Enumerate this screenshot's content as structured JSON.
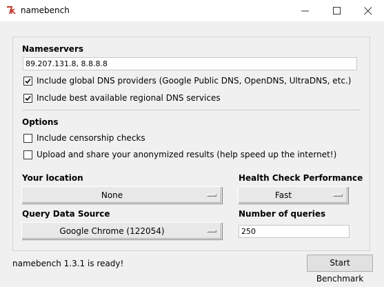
{
  "window": {
    "title": "namebench",
    "app_icon": "tk-feather-icon",
    "minimize_icon": "minimize-icon",
    "maximize_icon": "maximize-icon",
    "close_icon": "close-icon"
  },
  "nameservers": {
    "label": "Nameservers",
    "value": "89.207.131.8, 8.8.8.8",
    "include_global": {
      "label": "Include global DNS providers (Google Public DNS, OpenDNS, UltraDNS, etc.)",
      "checked": true
    },
    "include_regional": {
      "label": "Include best available regional DNS services",
      "checked": true
    }
  },
  "options": {
    "label": "Options",
    "censorship": {
      "label": "Include censorship checks",
      "checked": false
    },
    "upload": {
      "label": "Upload and share your anonymized results (help speed up the internet!)",
      "checked": false
    }
  },
  "location": {
    "label": "Your location",
    "selected": "None"
  },
  "health": {
    "label": "Health Check Performance",
    "selected": "Fast"
  },
  "query_source": {
    "label": "Query Data Source",
    "selected": "Google Chrome (122054)"
  },
  "num_queries": {
    "label": "Number of queries",
    "value": "250"
  },
  "footer": {
    "status": "namebench 1.3.1 is ready!",
    "start_button": "Start Benchmark"
  },
  "colors": {
    "titlebar": "#ffffff",
    "window_bg": "#f0f0f0",
    "icon_accent": "#c0392b"
  }
}
